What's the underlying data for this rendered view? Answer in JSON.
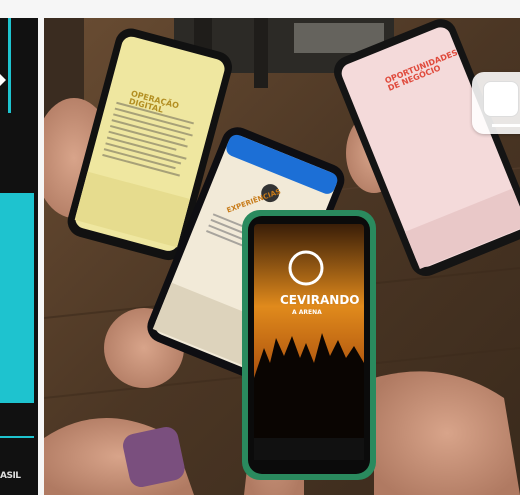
{
  "left_panel": {
    "logo_text": "ASIL",
    "colors": {
      "background": "#111111",
      "accent": "#1ec3cf"
    }
  },
  "photo": {
    "description_icon": "phones-photo",
    "phone_yellow": {
      "title": "OPERAÇÃO\nDIGITAL"
    },
    "phone_cream": {
      "headline": "EXPERIÊNCIAS"
    },
    "phone_pink": {
      "title": "OPORTUNIDADES\nDE NEGÓCIO"
    },
    "phone_concert": {
      "title": "CEVIRANDO",
      "subtitle": "A ARENA"
    }
  },
  "overlay": {
    "copy_icon": "copy-icon"
  }
}
